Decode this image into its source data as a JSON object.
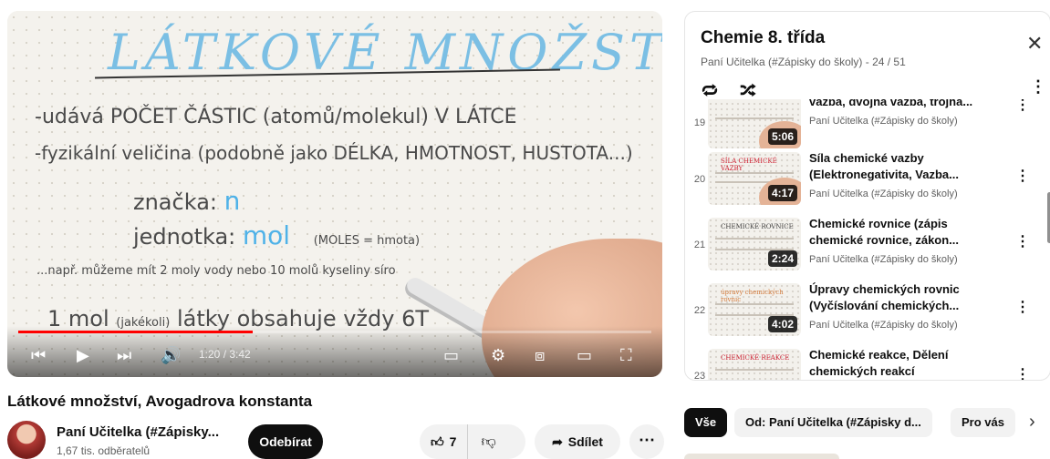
{
  "video": {
    "board": {
      "title": "LÁTKOVÉ MNOŽSTVÍ",
      "line1": "-udává POČET ČÁSTIC (atomů/molekul) V LÁTCE",
      "line2": "-fyzikální veličina (podobně jako DÉLKA, HMOTNOST, HUSTOTA...)",
      "line3_label": "značka:",
      "line3_value": "n",
      "line4_label": "jednotka:",
      "line4_value": "mol",
      "line4_note": "(MOLES = hmota)",
      "line5": "...např. můžeme mít 2 moly vody nebo 10 molů kyseliny síro",
      "line6_a": "1 mol",
      "line6_b": "(jakékoli)",
      "line6_c": "látky obsahuje vždy 6T"
    },
    "progress_fraction": 0.37,
    "time": "1:20 / 3:42",
    "title": "Látkové množství, Avogadrova konstanta"
  },
  "channel": {
    "name": "Paní Učitelka (#Zápisky...",
    "subscribers": "1,67 tis. odběratelů",
    "subscribe_label": "Odebírat"
  },
  "actions": {
    "likes": "7",
    "share_label": "Sdílet"
  },
  "playlist": {
    "title": "Chemie 8. třída",
    "subtitle": "Paní Učitelka (#Zápisky do školy) - 24 / 51",
    "items": [
      {
        "index": "19",
        "title": "vazba, dvojná vazba, trojná...",
        "title2": "",
        "channel": "Paní Učitelka (#Zápisky do školy)",
        "duration": "5:06",
        "thumb_heading": ""
      },
      {
        "index": "20",
        "title": "Síla chemické vazby",
        "title2": "(Elektronegativita, Vazba...",
        "channel": "Paní Učitelka (#Zápisky do školy)",
        "duration": "4:17",
        "thumb_heading": "SÍLA CHEMICKÉ VAZBY"
      },
      {
        "index": "21",
        "title": "Chemické rovnice (zápis",
        "title2": "chemické rovnice, zákon...",
        "channel": "Paní Učitelka (#Zápisky do školy)",
        "duration": "2:24",
        "thumb_heading": "CHEMICKÉ ROVNICE"
      },
      {
        "index": "22",
        "title": "Úpravy chemických rovnic",
        "title2": "(Vyčíslování chemických...",
        "channel": "Paní Učitelka (#Zápisky do školy)",
        "duration": "4:02",
        "thumb_heading": "úpravy chemických rovnic"
      },
      {
        "index": "23",
        "title": "Chemické reakce, Dělení",
        "title2": "chemických reakcí",
        "channel": "",
        "duration": "",
        "thumb_heading": "CHEMICKÉ REAKCE"
      }
    ]
  },
  "chips": {
    "all": "Vše",
    "from": "Od: Paní Učitelka (#Zápisky d...",
    "for_you": "Pro vás"
  },
  "colors": {
    "progress": "#ff0000",
    "accent_blue": "#4fb2e8"
  }
}
